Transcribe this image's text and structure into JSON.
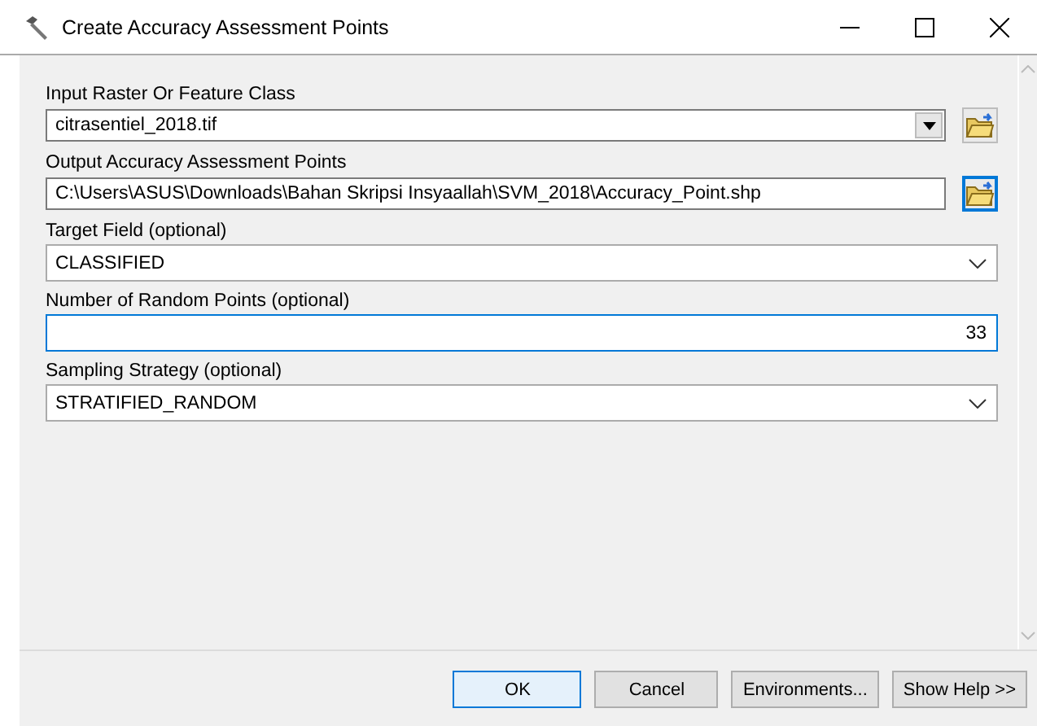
{
  "window": {
    "title": "Create Accuracy Assessment Points"
  },
  "parameters": [
    {
      "label": "Input Raster Or Feature Class",
      "kind": "combo",
      "value": "citrasentiel_2018.tif",
      "focused": false,
      "browse": {
        "focused": false
      }
    },
    {
      "label": "Output Accuracy Assessment Points",
      "kind": "text",
      "value": "C:\\Users\\ASUS\\Downloads\\Bahan Skripsi Insyaallah\\SVM_2018\\Accuracy_Point.shp",
      "focused": false,
      "browse": {
        "focused": true
      }
    },
    {
      "label": "Target Field (optional)",
      "kind": "dropdown",
      "value": "CLASSIFIED",
      "focused": false
    },
    {
      "label": "Number of Random Points (optional)",
      "kind": "number",
      "value": "33",
      "focused": true
    },
    {
      "label": "Sampling Strategy (optional)",
      "kind": "dropdown",
      "value": "STRATIFIED_RANDOM",
      "focused": false
    }
  ],
  "buttons": [
    {
      "label": "OK",
      "default": true
    },
    {
      "label": "Cancel",
      "default": false
    },
    {
      "label": "Environments...",
      "default": false
    },
    {
      "label": "Show Help >>",
      "default": false
    }
  ]
}
